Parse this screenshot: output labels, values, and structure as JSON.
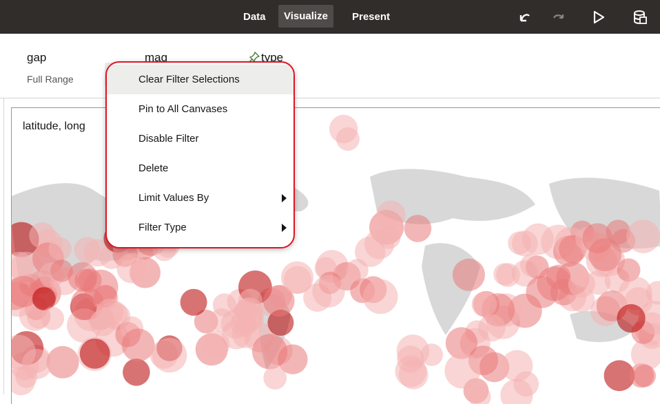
{
  "toolbar": {
    "tabs": [
      {
        "label": "Data"
      },
      {
        "label": "Visualize",
        "active": true
      },
      {
        "label": "Present"
      }
    ],
    "icons": [
      "undo-icon",
      "redo-icon",
      "play-icon",
      "save-icon"
    ],
    "background": "#312d2a"
  },
  "filters": [
    {
      "name": "gap",
      "subtitle": "Full Range"
    },
    {
      "name": "mag",
      "subtitle": ""
    },
    {
      "name": "type",
      "subtitle": "",
      "pinned": true
    }
  ],
  "viz": {
    "title": "latitude, long"
  },
  "context_menu": {
    "items": [
      {
        "label": "Clear Filter Selections",
        "highlighted": true,
        "submenu": false
      },
      {
        "label": "Pin to All Canvases",
        "submenu": false
      },
      {
        "label": "Disable Filter",
        "submenu": false
      },
      {
        "label": "Delete",
        "submenu": false
      },
      {
        "label": "Limit Values By",
        "submenu": true
      },
      {
        "label": "Filter Type",
        "submenu": true
      }
    ],
    "outline_color": "#e0131f"
  },
  "colors": {
    "marker_light": "#f4b3b3",
    "marker_mid": "#e97a7a",
    "marker_dark": "#b80000",
    "land": "#d8d8d8"
  }
}
